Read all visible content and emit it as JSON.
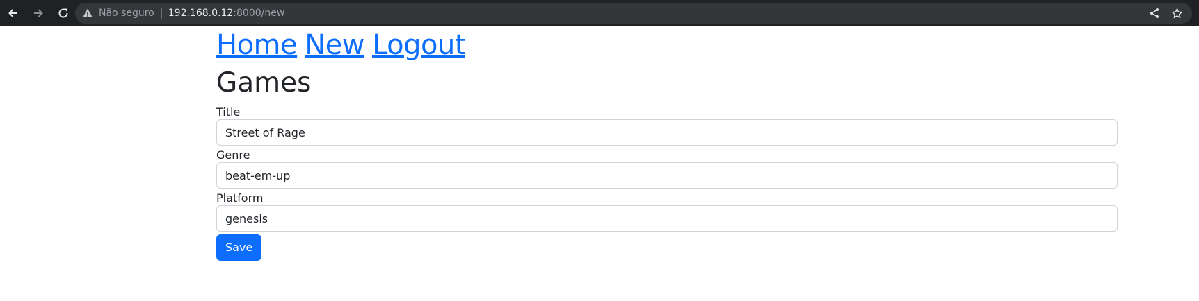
{
  "browser": {
    "security_label": "Não seguro",
    "url_host": "192.168.0.12",
    "url_path": ":8000/new"
  },
  "nav": {
    "links": [
      "Home",
      "New",
      "Logout"
    ]
  },
  "page": {
    "title": "Games"
  },
  "form": {
    "fields": [
      {
        "label": "Title",
        "value": "Street of Rage"
      },
      {
        "label": "Genre",
        "value": "beat-em-up"
      },
      {
        "label": "Platform",
        "value": "genesis"
      }
    ],
    "save_label": "Save"
  },
  "colors": {
    "link": "#0d6efd",
    "primary_button": "#0d6efd",
    "chrome_bg": "#202124"
  },
  "icons": [
    "back-arrow-icon",
    "forward-arrow-icon",
    "reload-icon",
    "warning-icon",
    "share-icon",
    "star-icon"
  ]
}
